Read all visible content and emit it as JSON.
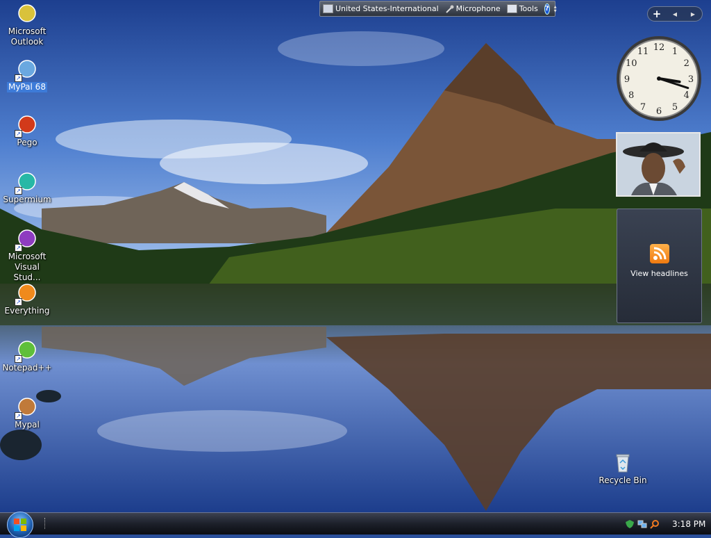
{
  "desktop_icons": [
    {
      "label": "Microsoft Outlook",
      "icon": "outlook-icon",
      "color": "#d9c23b",
      "selected": false
    },
    {
      "label": "MyPal 68",
      "icon": "mypal-68-icon",
      "color": "#6aa8e0",
      "selected": true
    },
    {
      "label": "Pego",
      "icon": "pego-icon",
      "color": "#d23a1a",
      "selected": false
    },
    {
      "label": "Supermium",
      "icon": "supermium-icon",
      "color": "#27b8a6",
      "selected": false
    },
    {
      "label": "Microsoft Visual Stud...",
      "icon": "visual-studio-icon",
      "color": "#8e3cc0",
      "selected": false
    },
    {
      "label": "Everything",
      "icon": "everything-icon",
      "color": "#f08a1c",
      "selected": false
    },
    {
      "label": "Notepad++",
      "icon": "notepad-plus-plus-icon",
      "color": "#5fbf3a",
      "selected": false
    },
    {
      "label": "Mypal",
      "icon": "mypal-icon",
      "color": "#c07a3a",
      "selected": false
    }
  ],
  "recycle_bin": {
    "label": "Recycle Bin",
    "icon": "recycle-bin-icon"
  },
  "language_bar": {
    "language": "United States-International",
    "microphone": "Microphone",
    "tools": "Tools",
    "help": "?"
  },
  "sidebar": {
    "add": "+",
    "prev": "◀",
    "next": "▶"
  },
  "gadgets": {
    "clock": {
      "hour": 3,
      "minute": 18
    },
    "feed": {
      "label": "View headlines",
      "icon": "rss-icon"
    }
  },
  "taskbar": {
    "time": "3:18 PM"
  },
  "colors": {
    "selection": "#3d7bd8",
    "taskbar": "#1c202a"
  }
}
